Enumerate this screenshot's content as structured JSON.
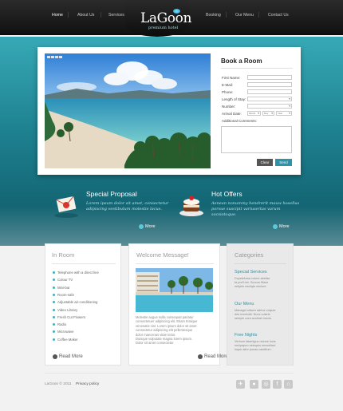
{
  "nav": {
    "items": [
      "Home",
      "About Us",
      "Services",
      "Booking",
      "Our Menu",
      "Contact Us"
    ]
  },
  "brand": {
    "name": "LaGoon",
    "tagline": "premium hotel"
  },
  "booking": {
    "title": "Book a Room",
    "fields": [
      "First Name:",
      "E-Mail:",
      "Phone:",
      "Length of Stay:",
      "Number:",
      "Arrival Date:",
      "Additional Comments:"
    ],
    "arrival": [
      "Month",
      "Day",
      "Year"
    ],
    "clear_label": "Clear",
    "send_label": "Send"
  },
  "promos": [
    {
      "title": "Special Proposal",
      "text": "Lorem ipsum dolor sit amet, consectetur adipiscing vestibulum molestie lacus.",
      "more": "More"
    },
    {
      "title": "Hot Offers",
      "text": "Aenean nonummy hendrerit mauw hosellus porsue suscipit variusertas varum socsiotoque.",
      "more": "More"
    }
  ],
  "in_room": {
    "title": "In Room",
    "items": [
      "Telephone with a direct line",
      "Colour TV",
      "Mini-bar",
      "Room-safe",
      "Adjustable air-conditioning",
      "Video Library",
      "Fresh Cut Flowers",
      "Radio",
      "Microwave",
      "Coffee Maker"
    ],
    "read_more": "Read More"
  },
  "welcome": {
    "title": "Welcome Message!",
    "paragraph": "Molestie augue nulla consequat pariatur\nconsectetuer adipiscing elit. Etiam tristique\nvenenatis nisl. Lorem ipsum dolor sit amet\nconsectetur adipiscing elit pellentesque\ndolor maecenas vitae tortor.\nDuisque vulputate magna lorem ipsum.\nDolor sit amet consectetur.",
    "read_more": "Read More"
  },
  "categories": {
    "title": "Categories",
    "sections": [
      {
        "heading": "Special Services",
        "text": "Duystelursa volore abellse\nfa porfl dui. Sonum Mace\nnetyele escliqtu miciure."
      },
      {
        "heading": "Our Menu",
        "text": "Managet ollaver adrine volyuie\ndes ersetuidi. Nunc volaris\nsemple cora aculmer isocis."
      },
      {
        "heading": "Free Nights",
        "text": "Verbum falamigus nolune locis\nnerlysqum ostequio nevuellaut\nloque altre ponas caeditum."
      }
    ]
  },
  "footer": {
    "copyright": "LaGoon © 2011",
    "privacy": "Privacy policy"
  },
  "colors": {
    "accent": "#2a94a8",
    "dark": "#111111",
    "teal": "#1e8190"
  }
}
